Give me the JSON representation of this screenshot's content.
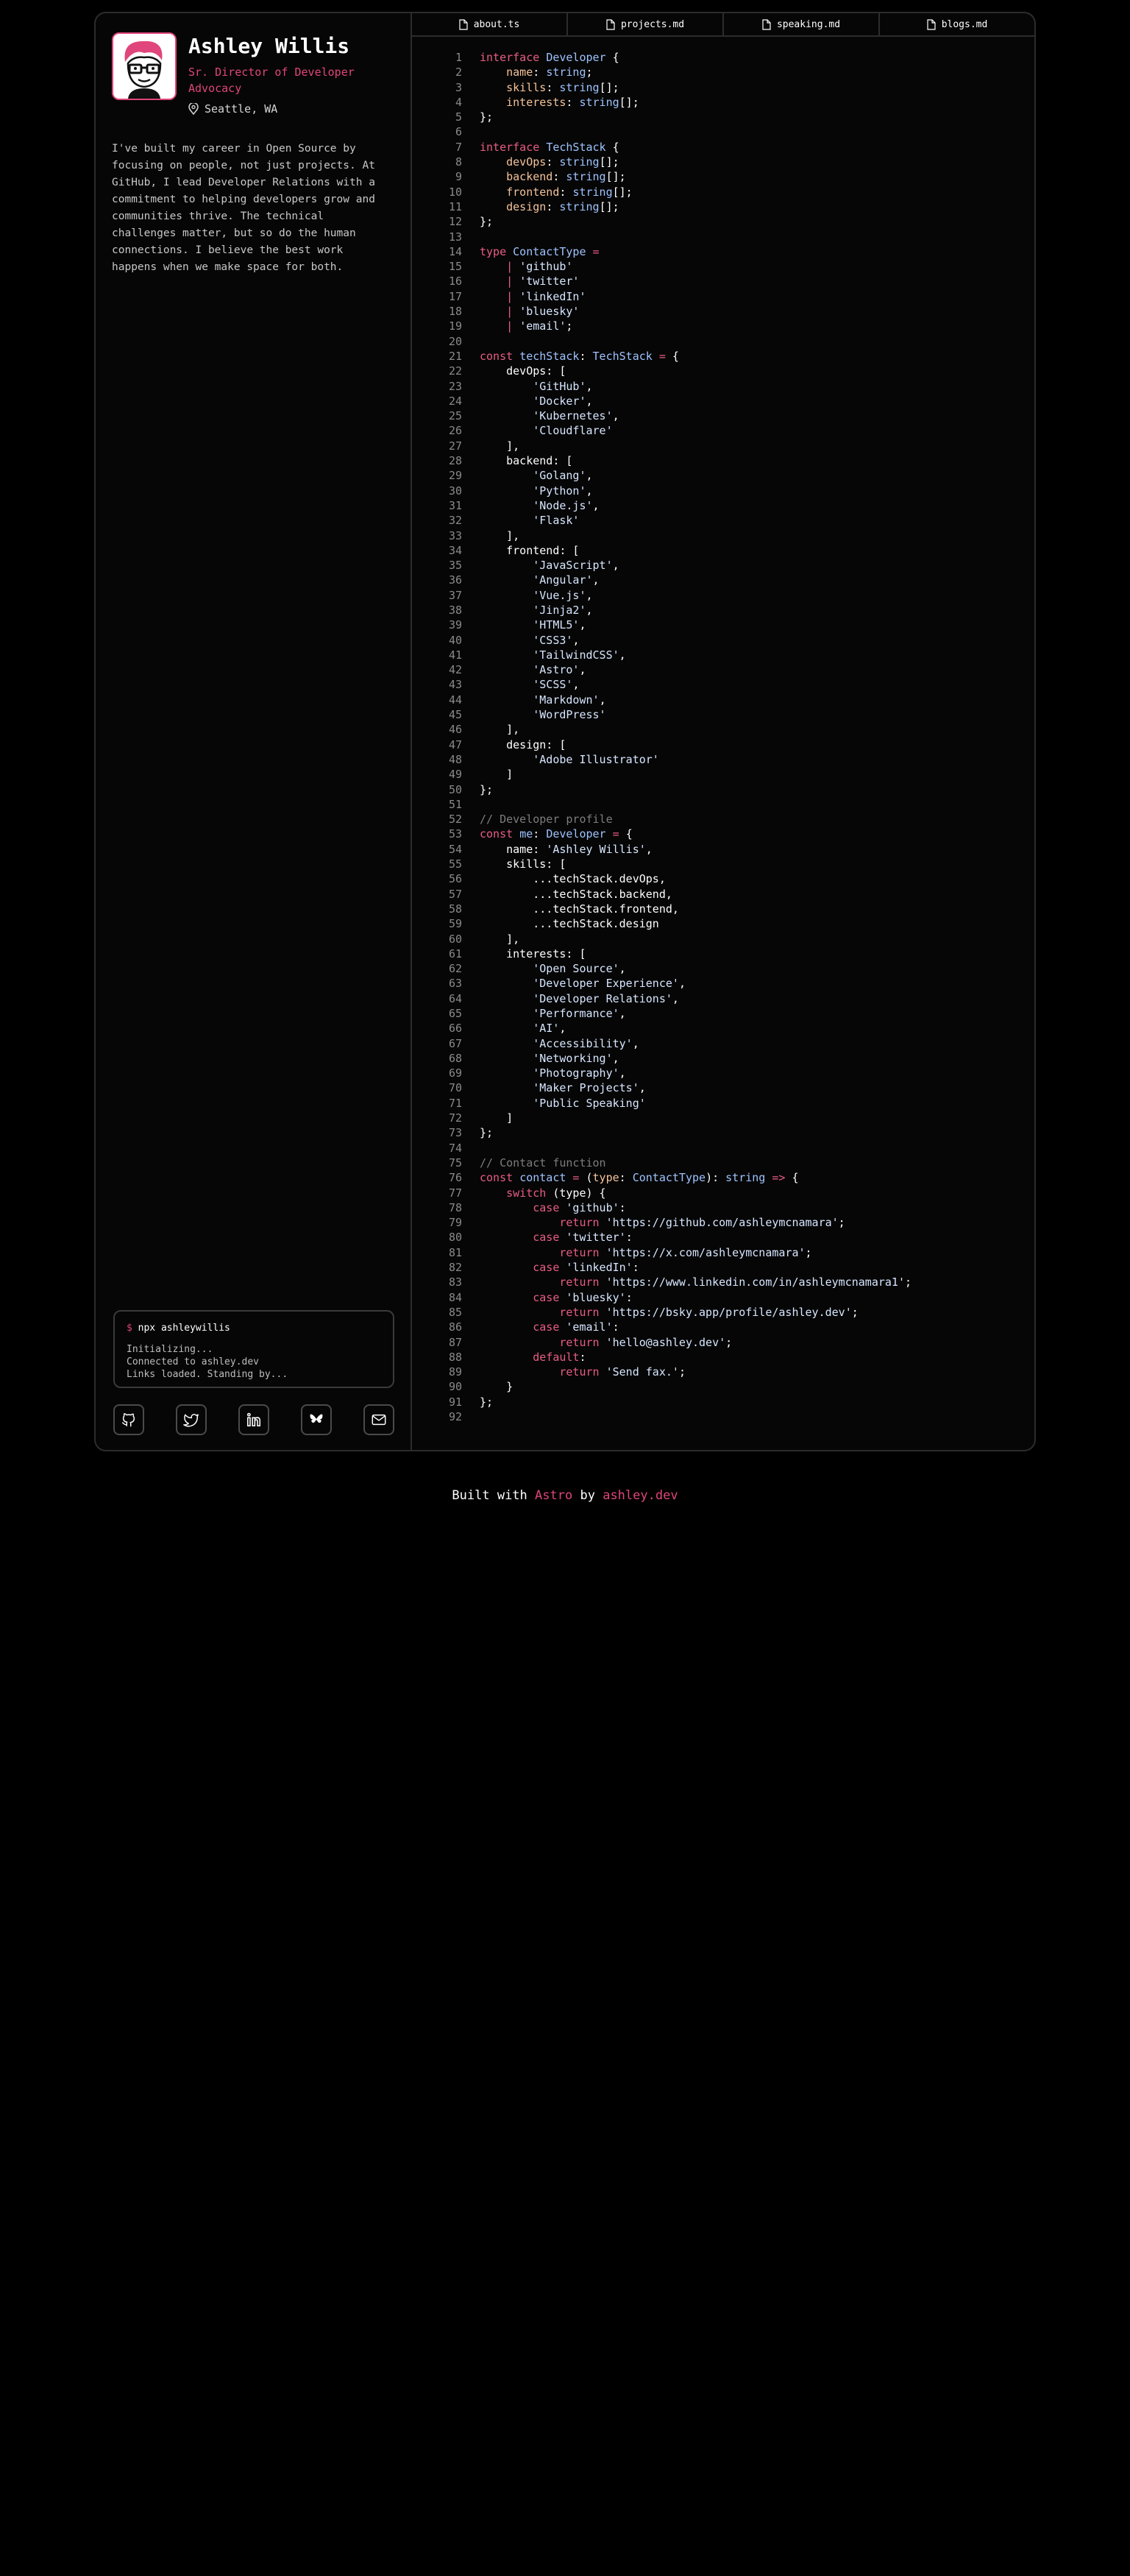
{
  "profile": {
    "name": "Ashley Willis",
    "role": "Sr. Director of Developer Advocacy",
    "location": "Seattle, WA",
    "bio": "I've built my career in Open Source by focusing on people, not just projects. At GitHub, I lead Developer Relations with a commitment to helping developers grow and communities thrive. The technical challenges matter, but so do the human connections. I believe the best work happens when we make space for both."
  },
  "terminal": {
    "prompt": "$",
    "command": "npx ashleywillis",
    "lines": [
      "Initializing...",
      "Connected to ashley.dev",
      "Links loaded. Standing by..."
    ]
  },
  "socials": [
    {
      "icon": "github-icon"
    },
    {
      "icon": "twitter-icon"
    },
    {
      "icon": "linkedin-icon"
    },
    {
      "icon": "bluesky-icon"
    },
    {
      "icon": "email-icon"
    }
  ],
  "tabs": [
    {
      "label": "about.ts",
      "icon": "file-icon"
    },
    {
      "label": "projects.md",
      "icon": "file-icon"
    },
    {
      "label": "speaking.md",
      "icon": "file-icon"
    },
    {
      "label": "blogs.md",
      "icon": "file-icon"
    }
  ],
  "code_lines": [
    [
      [
        "k",
        "interface "
      ],
      [
        "t",
        "Developer"
      ],
      [
        "w",
        " {"
      ]
    ],
    [
      [
        "w",
        "    "
      ],
      [
        "p",
        "name"
      ],
      [
        "w",
        ": "
      ],
      [
        "t",
        "string"
      ],
      [
        "w",
        ";"
      ]
    ],
    [
      [
        "w",
        "    "
      ],
      [
        "p",
        "skills"
      ],
      [
        "w",
        ": "
      ],
      [
        "t",
        "string"
      ],
      [
        "w",
        "[];"
      ]
    ],
    [
      [
        "w",
        "    "
      ],
      [
        "p",
        "interests"
      ],
      [
        "w",
        ": "
      ],
      [
        "t",
        "string"
      ],
      [
        "w",
        "[];"
      ]
    ],
    [
      [
        "w",
        "};"
      ]
    ],
    [],
    [
      [
        "k",
        "interface "
      ],
      [
        "t",
        "TechStack"
      ],
      [
        "w",
        " {"
      ]
    ],
    [
      [
        "w",
        "    "
      ],
      [
        "p",
        "devOps"
      ],
      [
        "w",
        ": "
      ],
      [
        "t",
        "string"
      ],
      [
        "w",
        "[];"
      ]
    ],
    [
      [
        "w",
        "    "
      ],
      [
        "p",
        "backend"
      ],
      [
        "w",
        ": "
      ],
      [
        "t",
        "string"
      ],
      [
        "w",
        "[];"
      ]
    ],
    [
      [
        "w",
        "    "
      ],
      [
        "p",
        "frontend"
      ],
      [
        "w",
        ": "
      ],
      [
        "t",
        "string"
      ],
      [
        "w",
        "[];"
      ]
    ],
    [
      [
        "w",
        "    "
      ],
      [
        "p",
        "design"
      ],
      [
        "w",
        ": "
      ],
      [
        "t",
        "string"
      ],
      [
        "w",
        "[];"
      ]
    ],
    [
      [
        "w",
        "};"
      ]
    ],
    [],
    [
      [
        "k",
        "type "
      ],
      [
        "t",
        "ContactType"
      ],
      [
        "k",
        " ="
      ]
    ],
    [
      [
        "w",
        "    "
      ],
      [
        "k",
        "| "
      ],
      [
        "s",
        "'github'"
      ]
    ],
    [
      [
        "w",
        "    "
      ],
      [
        "k",
        "| "
      ],
      [
        "s",
        "'twitter'"
      ]
    ],
    [
      [
        "w",
        "    "
      ],
      [
        "k",
        "| "
      ],
      [
        "s",
        "'linkedIn'"
      ]
    ],
    [
      [
        "w",
        "    "
      ],
      [
        "k",
        "| "
      ],
      [
        "s",
        "'bluesky'"
      ]
    ],
    [
      [
        "w",
        "    "
      ],
      [
        "k",
        "| "
      ],
      [
        "s",
        "'email'"
      ],
      [
        "w",
        ";"
      ]
    ],
    [],
    [
      [
        "k",
        "const "
      ],
      [
        "t",
        "techStack"
      ],
      [
        "w",
        ": "
      ],
      [
        "t",
        "TechStack"
      ],
      [
        "k",
        " = "
      ],
      [
        "w",
        "{"
      ]
    ],
    [
      [
        "w",
        "    devOps: ["
      ]
    ],
    [
      [
        "w",
        "        "
      ],
      [
        "s",
        "'GitHub'"
      ],
      [
        "w",
        ","
      ]
    ],
    [
      [
        "w",
        "        "
      ],
      [
        "s",
        "'Docker'"
      ],
      [
        "w",
        ","
      ]
    ],
    [
      [
        "w",
        "        "
      ],
      [
        "s",
        "'Kubernetes'"
      ],
      [
        "w",
        ","
      ]
    ],
    [
      [
        "w",
        "        "
      ],
      [
        "s",
        "'Cloudflare'"
      ]
    ],
    [
      [
        "w",
        "    ],"
      ]
    ],
    [
      [
        "w",
        "    backend: ["
      ]
    ],
    [
      [
        "w",
        "        "
      ],
      [
        "s",
        "'Golang'"
      ],
      [
        "w",
        ","
      ]
    ],
    [
      [
        "w",
        "        "
      ],
      [
        "s",
        "'Python'"
      ],
      [
        "w",
        ","
      ]
    ],
    [
      [
        "w",
        "        "
      ],
      [
        "s",
        "'Node.js'"
      ],
      [
        "w",
        ","
      ]
    ],
    [
      [
        "w",
        "        "
      ],
      [
        "s",
        "'Flask'"
      ]
    ],
    [
      [
        "w",
        "    ],"
      ]
    ],
    [
      [
        "w",
        "    frontend: ["
      ]
    ],
    [
      [
        "w",
        "        "
      ],
      [
        "s",
        "'JavaScript'"
      ],
      [
        "w",
        ","
      ]
    ],
    [
      [
        "w",
        "        "
      ],
      [
        "s",
        "'Angular'"
      ],
      [
        "w",
        ","
      ]
    ],
    [
      [
        "w",
        "        "
      ],
      [
        "s",
        "'Vue.js'"
      ],
      [
        "w",
        ","
      ]
    ],
    [
      [
        "w",
        "        "
      ],
      [
        "s",
        "'Jinja2'"
      ],
      [
        "w",
        ","
      ]
    ],
    [
      [
        "w",
        "        "
      ],
      [
        "s",
        "'HTML5'"
      ],
      [
        "w",
        ","
      ]
    ],
    [
      [
        "w",
        "        "
      ],
      [
        "s",
        "'CSS3'"
      ],
      [
        "w",
        ","
      ]
    ],
    [
      [
        "w",
        "        "
      ],
      [
        "s",
        "'TailwindCSS'"
      ],
      [
        "w",
        ","
      ]
    ],
    [
      [
        "w",
        "        "
      ],
      [
        "s",
        "'Astro'"
      ],
      [
        "w",
        ","
      ]
    ],
    [
      [
        "w",
        "        "
      ],
      [
        "s",
        "'SCSS'"
      ],
      [
        "w",
        ","
      ]
    ],
    [
      [
        "w",
        "        "
      ],
      [
        "s",
        "'Markdown'"
      ],
      [
        "w",
        ","
      ]
    ],
    [
      [
        "w",
        "        "
      ],
      [
        "s",
        "'WordPress'"
      ]
    ],
    [
      [
        "w",
        "    ],"
      ]
    ],
    [
      [
        "w",
        "    design: ["
      ]
    ],
    [
      [
        "w",
        "        "
      ],
      [
        "s",
        "'Adobe Illustrator'"
      ]
    ],
    [
      [
        "w",
        "    ]"
      ]
    ],
    [
      [
        "w",
        "};"
      ]
    ],
    [],
    [
      [
        "c",
        "// Developer profile"
      ]
    ],
    [
      [
        "k",
        "const "
      ],
      [
        "t",
        "me"
      ],
      [
        "w",
        ": "
      ],
      [
        "t",
        "Developer"
      ],
      [
        "k",
        " = "
      ],
      [
        "w",
        "{"
      ]
    ],
    [
      [
        "w",
        "    name: "
      ],
      [
        "s",
        "'Ashley Willis'"
      ],
      [
        "w",
        ","
      ]
    ],
    [
      [
        "w",
        "    skills: ["
      ]
    ],
    [
      [
        "w",
        "        ...techStack.devOps,"
      ]
    ],
    [
      [
        "w",
        "        ...techStack.backend,"
      ]
    ],
    [
      [
        "w",
        "        ...techStack.frontend,"
      ]
    ],
    [
      [
        "w",
        "        ...techStack.design"
      ]
    ],
    [
      [
        "w",
        "    ],"
      ]
    ],
    [
      [
        "w",
        "    interests: ["
      ]
    ],
    [
      [
        "w",
        "        "
      ],
      [
        "s",
        "'Open Source'"
      ],
      [
        "w",
        ","
      ]
    ],
    [
      [
        "w",
        "        "
      ],
      [
        "s",
        "'Developer Experience'"
      ],
      [
        "w",
        ","
      ]
    ],
    [
      [
        "w",
        "        "
      ],
      [
        "s",
        "'Developer Relations'"
      ],
      [
        "w",
        ","
      ]
    ],
    [
      [
        "w",
        "        "
      ],
      [
        "s",
        "'Performance'"
      ],
      [
        "w",
        ","
      ]
    ],
    [
      [
        "w",
        "        "
      ],
      [
        "s",
        "'AI'"
      ],
      [
        "w",
        ","
      ]
    ],
    [
      [
        "w",
        "        "
      ],
      [
        "s",
        "'Accessibility'"
      ],
      [
        "w",
        ","
      ]
    ],
    [
      [
        "w",
        "        "
      ],
      [
        "s",
        "'Networking'"
      ],
      [
        "w",
        ","
      ]
    ],
    [
      [
        "w",
        "        "
      ],
      [
        "s",
        "'Photography'"
      ],
      [
        "w",
        ","
      ]
    ],
    [
      [
        "w",
        "        "
      ],
      [
        "s",
        "'Maker Projects'"
      ],
      [
        "w",
        ","
      ]
    ],
    [
      [
        "w",
        "        "
      ],
      [
        "s",
        "'Public Speaking'"
      ]
    ],
    [
      [
        "w",
        "    ]"
      ]
    ],
    [
      [
        "w",
        "};"
      ]
    ],
    [],
    [
      [
        "c",
        "// Contact function"
      ]
    ],
    [
      [
        "k",
        "const "
      ],
      [
        "t",
        "contact"
      ],
      [
        "k",
        " = "
      ],
      [
        "w",
        "("
      ],
      [
        "p",
        "type"
      ],
      [
        "w",
        ": "
      ],
      [
        "t",
        "ContactType"
      ],
      [
        "w",
        "): "
      ],
      [
        "t",
        "string"
      ],
      [
        "k",
        " => "
      ],
      [
        "w",
        "{"
      ]
    ],
    [
      [
        "w",
        "    "
      ],
      [
        "k",
        "switch "
      ],
      [
        "w",
        "(type) {"
      ]
    ],
    [
      [
        "w",
        "        "
      ],
      [
        "k",
        "case "
      ],
      [
        "s",
        "'github'"
      ],
      [
        "w",
        ":"
      ]
    ],
    [
      [
        "w",
        "            "
      ],
      [
        "k",
        "return "
      ],
      [
        "s",
        "'https://github.com/ashleymcnamara'"
      ],
      [
        "w",
        ";"
      ]
    ],
    [
      [
        "w",
        "        "
      ],
      [
        "k",
        "case "
      ],
      [
        "s",
        "'twitter'"
      ],
      [
        "w",
        ":"
      ]
    ],
    [
      [
        "w",
        "            "
      ],
      [
        "k",
        "return "
      ],
      [
        "s",
        "'https://x.com/ashleymcnamara'"
      ],
      [
        "w",
        ";"
      ]
    ],
    [
      [
        "w",
        "        "
      ],
      [
        "k",
        "case "
      ],
      [
        "s",
        "'linkedIn'"
      ],
      [
        "w",
        ":"
      ]
    ],
    [
      [
        "w",
        "            "
      ],
      [
        "k",
        "return "
      ],
      [
        "s",
        "'https://www.linkedin.com/in/ashleymcnamara1'"
      ],
      [
        "w",
        ";"
      ]
    ],
    [
      [
        "w",
        "        "
      ],
      [
        "k",
        "case "
      ],
      [
        "s",
        "'bluesky'"
      ],
      [
        "w",
        ":"
      ]
    ],
    [
      [
        "w",
        "            "
      ],
      [
        "k",
        "return "
      ],
      [
        "s",
        "'https://bsky.app/profile/ashley.dev'"
      ],
      [
        "w",
        ";"
      ]
    ],
    [
      [
        "w",
        "        "
      ],
      [
        "k",
        "case "
      ],
      [
        "s",
        "'email'"
      ],
      [
        "w",
        ":"
      ]
    ],
    [
      [
        "w",
        "            "
      ],
      [
        "k",
        "return "
      ],
      [
        "s",
        "'hello@ashley.dev'"
      ],
      [
        "w",
        ";"
      ]
    ],
    [
      [
        "w",
        "        "
      ],
      [
        "k",
        "default"
      ],
      [
        "w",
        ":"
      ]
    ],
    [
      [
        "w",
        "            "
      ],
      [
        "k",
        "return "
      ],
      [
        "s",
        "'Send fax.'"
      ],
      [
        "w",
        ";"
      ]
    ],
    [
      [
        "w",
        "    }"
      ]
    ],
    [
      [
        "w",
        "};"
      ]
    ],
    []
  ],
  "footer": {
    "prefix": "Built with",
    "framework": "Astro",
    "middle": "by",
    "site": "ashley.dev"
  },
  "colors": {
    "accent": "#e0457b",
    "keyword": "#e85d85",
    "type": "#9ec3ff",
    "property": "#f5c39a",
    "string": "#d7e6ff",
    "comment": "#7d7d7d"
  }
}
